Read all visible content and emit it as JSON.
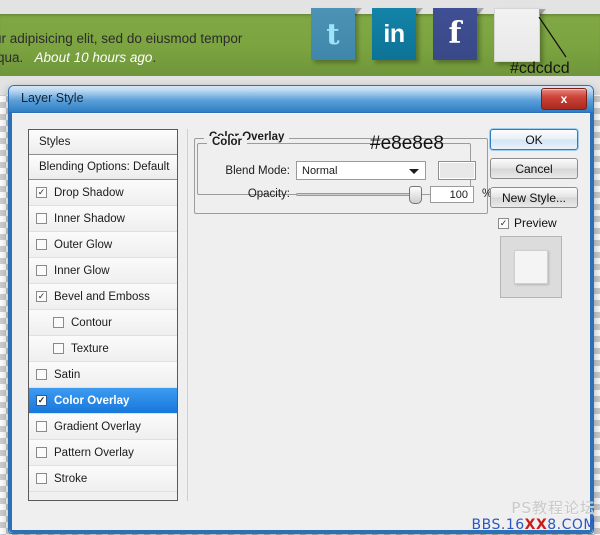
{
  "banner": {
    "line1": "ur adipisicing elit, sed do eiusmod tempor",
    "line2_main": "iqua.",
    "line2_ago": "About 10 hours ago",
    "line2_period": ".",
    "annotation_color": "#cdcdcd",
    "social_icons": [
      {
        "name": "twitter",
        "glyph": "t",
        "color": "#3f87aa"
      },
      {
        "name": "linkedin",
        "glyph": "in",
        "color": "#0d7396"
      },
      {
        "name": "facebook",
        "glyph": "f",
        "color": "#394887"
      },
      {
        "name": "blank",
        "glyph": "",
        "color": "#e8e8e8"
      }
    ]
  },
  "dialog": {
    "title": "Layer Style",
    "close_label": "x"
  },
  "styles_panel": {
    "header": "Styles",
    "blending_options": "Blending Options: Default",
    "items": [
      {
        "label": "Drop Shadow",
        "checked": true,
        "indent": false,
        "selected": false
      },
      {
        "label": "Inner Shadow",
        "checked": false,
        "indent": false,
        "selected": false
      },
      {
        "label": "Outer Glow",
        "checked": false,
        "indent": false,
        "selected": false
      },
      {
        "label": "Inner Glow",
        "checked": false,
        "indent": false,
        "selected": false
      },
      {
        "label": "Bevel and Emboss",
        "checked": true,
        "indent": false,
        "selected": false
      },
      {
        "label": "Contour",
        "checked": false,
        "indent": true,
        "selected": false
      },
      {
        "label": "Texture",
        "checked": false,
        "indent": true,
        "selected": false
      },
      {
        "label": "Satin",
        "checked": false,
        "indent": false,
        "selected": false
      },
      {
        "label": "Color Overlay",
        "checked": true,
        "indent": false,
        "selected": true
      },
      {
        "label": "Gradient Overlay",
        "checked": false,
        "indent": false,
        "selected": false
      },
      {
        "label": "Pattern Overlay",
        "checked": false,
        "indent": false,
        "selected": false
      },
      {
        "label": "Stroke",
        "checked": false,
        "indent": false,
        "selected": false
      }
    ]
  },
  "settings": {
    "group_title": "Color Overlay",
    "color_group_title": "Color",
    "blend_mode_label": "Blend Mode:",
    "blend_mode_value": "Normal",
    "blend_mode_options": [
      "Normal"
    ],
    "color_swatch_hex": "#e8e8e8",
    "opacity_label": "Opacity:",
    "opacity_value": "100",
    "opacity_percent": "%",
    "annotation_color": "#e8e8e8"
  },
  "buttons": {
    "ok": "OK",
    "cancel": "Cancel",
    "new_style": "New Style...",
    "preview_label": "Preview",
    "preview_checked": true
  },
  "watermark": {
    "cn": "PS教程论坛",
    "url_prefix": "BBS.16",
    "url_highlight": "XX",
    "url_suffix": "8.COM"
  }
}
